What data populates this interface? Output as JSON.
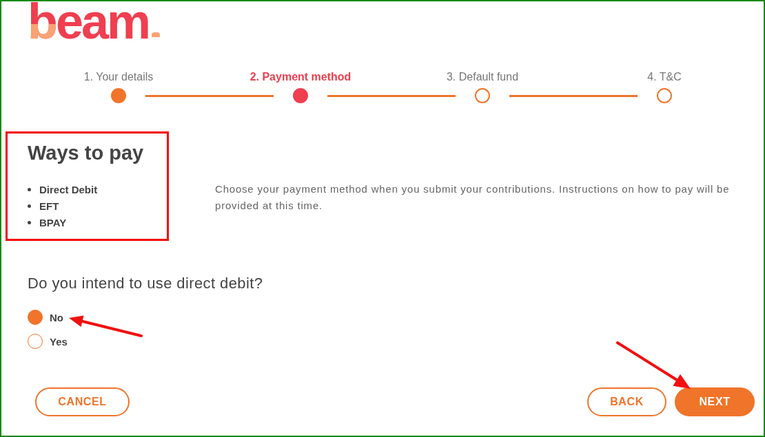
{
  "logo": "beam",
  "steps": [
    {
      "label": "1. Your details",
      "completed": true,
      "selected": false
    },
    {
      "label": "2. Payment method",
      "completed": false,
      "selected": true
    },
    {
      "label": "3. Default fund",
      "completed": false,
      "selected": false
    },
    {
      "label": "4. T&C",
      "completed": false,
      "selected": false
    }
  ],
  "ways_to_pay": {
    "title": "Ways to pay",
    "highlighted": true,
    "items": [
      "Direct Debit",
      "EFT",
      "BPAY"
    ]
  },
  "description": "Choose your payment method when you submit your contributions. Instructions on how to pay will be provided at this time.",
  "question": {
    "text": "Do you intend to use direct debit?",
    "options": [
      {
        "label": "No",
        "selected": true,
        "pointed_at": true
      },
      {
        "label": "Yes",
        "selected": false,
        "pointed_at": false
      }
    ]
  },
  "cancel_button": {
    "label": "CANCEL",
    "kind": "outline"
  },
  "nav_buttons": [
    {
      "label": "BACK",
      "kind": "outline",
      "pointed_at": false
    },
    {
      "label": "NEXT",
      "kind": "filled",
      "pointed_at": true
    }
  ]
}
